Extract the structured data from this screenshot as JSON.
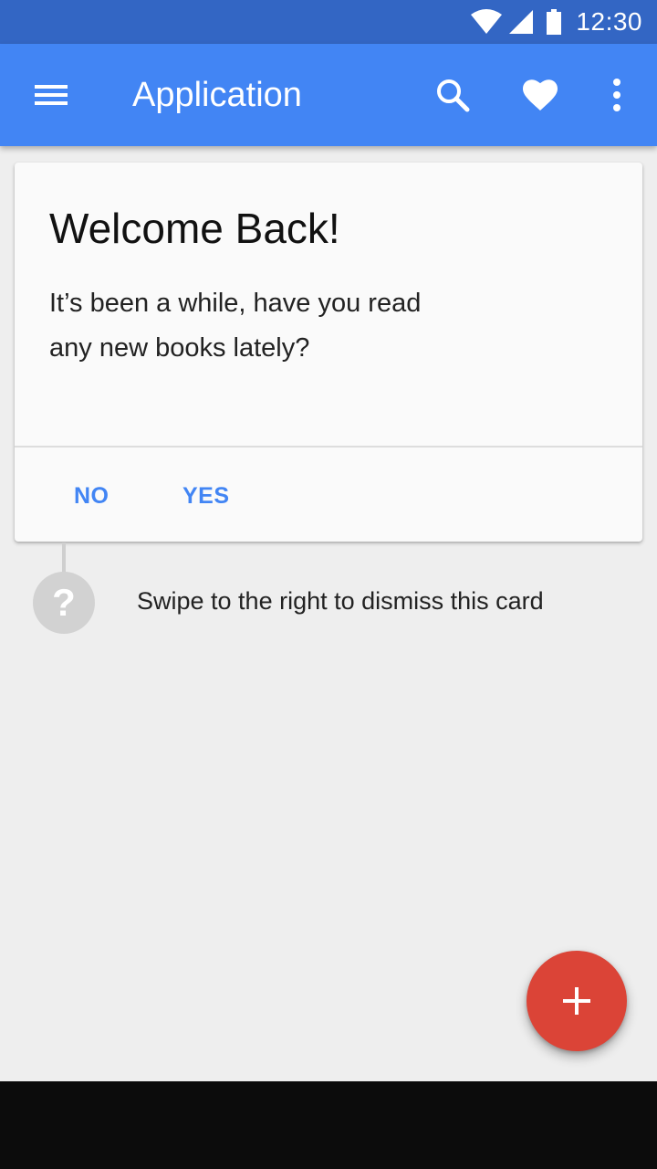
{
  "status_bar": {
    "time": "12:30",
    "icons": [
      "wifi-icon",
      "signal-icon",
      "battery-icon"
    ]
  },
  "app_bar": {
    "title": "Application",
    "icons": [
      "menu-icon",
      "search-icon",
      "heart-icon",
      "more-vert-icon"
    ],
    "color": "#4285f4"
  },
  "card": {
    "title": "Welcome Back!",
    "body": "It’s been a while, have you read any new books lately?",
    "actions": {
      "no_label": "NO",
      "yes_label": "YES"
    }
  },
  "hint": {
    "icon_glyph": "?",
    "text": "Swipe to the right to dismiss this card"
  },
  "fab": {
    "icon": "plus-icon",
    "color": "#db4437"
  },
  "colors": {
    "status_bar": "#3366c4",
    "accent": "#4285f4",
    "background": "#eeeeee",
    "nav_bar": "#0c0c0c"
  }
}
